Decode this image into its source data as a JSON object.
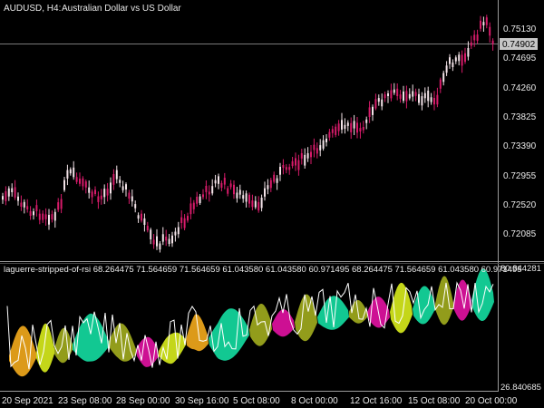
{
  "header": {
    "symbol_timeframe": "AUDUSD, H4:",
    "instrument_name": "Australian Dollar vs US Dollar"
  },
  "price_axis": {
    "ticks": [
      "0.75130",
      "0.74695",
      "0.74260",
      "0.73825",
      "0.73390",
      "0.72955",
      "0.72520",
      "0.72085"
    ],
    "current_price": "0.74902"
  },
  "indicator": {
    "title": "laguerre-stripped-of-rsi 68.264475 71.564659 71.564659 61.043580 61.043580 60.971495 68.264475 71.564659 61.043580 60.971495",
    "axis_top": "80.844281",
    "axis_bottom": "26.840685"
  },
  "time_axis": {
    "ticks": [
      "20 Sep 2021",
      "23 Sep 08:00",
      "28 Sep 00:00",
      "30 Sep 16:00",
      "5 Oct 08:00",
      "8 Oct 00:00",
      "12 Oct 16:00",
      "15 Oct 08:00",
      "20 Oct 00:00"
    ]
  },
  "colors": {
    "background": "#000000",
    "bull_candle": "#f3e3e8",
    "bear_candle": "#d81b6a",
    "grid_line": "#7a7a7a",
    "band_green": "#13d39a",
    "band_magenta": "#d8119b",
    "band_olive": "#9aa41c",
    "band_orange": "#e8a21a",
    "band_yellow": "#cfe21a",
    "rsi_line": "#ffffff"
  }
}
